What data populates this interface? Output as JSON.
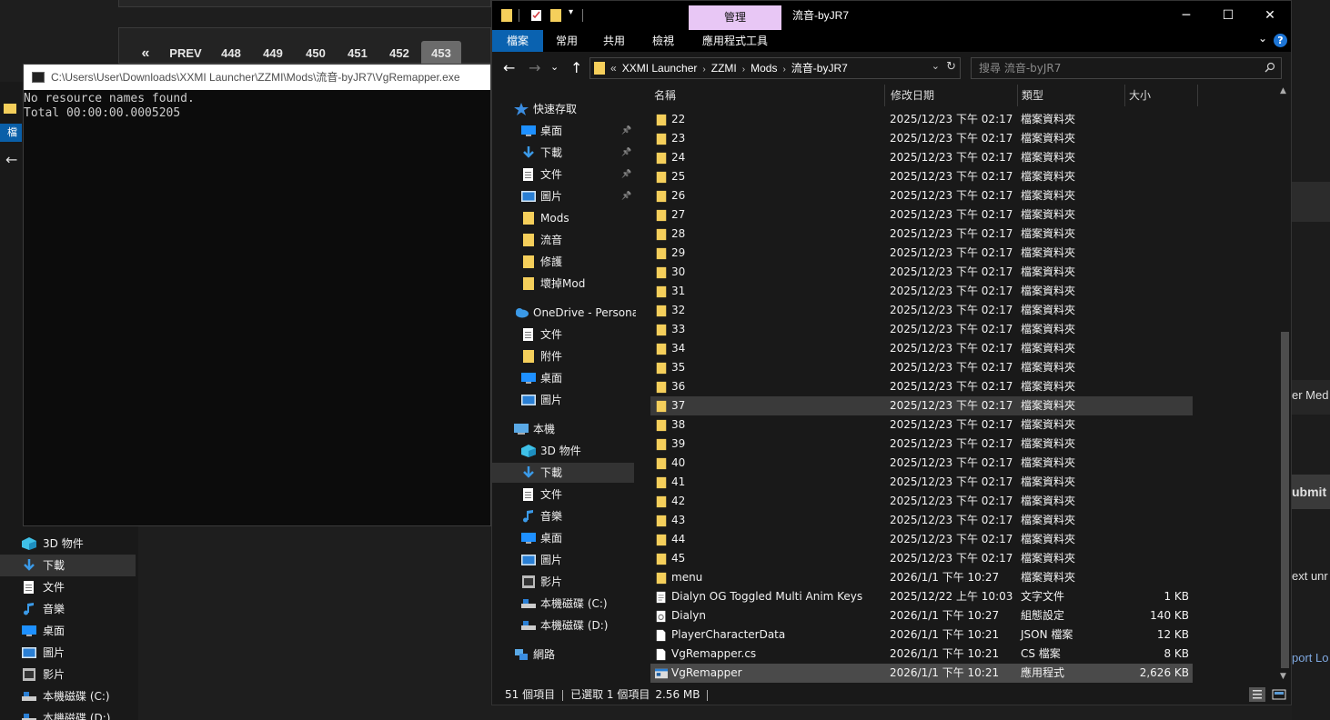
{
  "colors": {
    "folder": "#f5cf5b",
    "accent_blue": "#0a62b0",
    "manage_tab": "#e8c7f5",
    "selection": "#4a4a4a"
  },
  "background_page": {
    "pager": {
      "prev_symbol": "«",
      "prev_label": "PREV",
      "pages": [
        "448",
        "449",
        "450",
        "451",
        "452",
        "453"
      ],
      "active_page": "453"
    },
    "right_panel": {
      "text1": "er Med",
      "submit": "ubmit",
      "text2": "ext unr",
      "link": "port Lo"
    }
  },
  "console": {
    "title": "C:\\Users\\User\\Downloads\\XXMI Launcher\\ZZMI\\Mods\\流音-byJR7\\VgRemapper.exe",
    "output": "No resource names found.\nTotal 00:00:00.0005205"
  },
  "left_explorer": {
    "ribbon_label": "檔案",
    "nav_items": [
      {
        "label": "3D 物件",
        "icon": "3d-objects-icon"
      },
      {
        "label": "下載",
        "icon": "download-icon",
        "selected": true
      },
      {
        "label": "文件",
        "icon": "document-icon"
      },
      {
        "label": "音樂",
        "icon": "music-icon"
      },
      {
        "label": "桌面",
        "icon": "desktop-icon"
      },
      {
        "label": "圖片",
        "icon": "pictures-icon"
      },
      {
        "label": "影片",
        "icon": "videos-icon"
      },
      {
        "label": "本機磁碟 (C:)",
        "icon": "drive-icon"
      },
      {
        "label": "本機磁碟 (D:)",
        "icon": "drive-icon"
      }
    ]
  },
  "explorer": {
    "manage_tab": "管理",
    "title": "流音-byJR7",
    "window_buttons": {
      "minimize": "─",
      "maximize": "☐",
      "close": "✕"
    },
    "ribbon_tabs": [
      "檔案",
      "常用",
      "共用",
      "檢視",
      "應用程式工具"
    ],
    "address": {
      "prefix": "«",
      "crumbs": [
        "XXMI Launcher",
        "ZZMI",
        "Mods",
        "流音-byJR7"
      ]
    },
    "search_placeholder": "搜尋 流音-byJR7",
    "nav_pane": [
      {
        "label": "快速存取",
        "icon": "star-icon",
        "level": 0
      },
      {
        "label": "桌面",
        "icon": "desktop-icon",
        "level": 1,
        "pinned": true
      },
      {
        "label": "下載",
        "icon": "download-icon",
        "level": 1,
        "pinned": true
      },
      {
        "label": "文件",
        "icon": "document-icon",
        "level": 1,
        "pinned": true
      },
      {
        "label": "圖片",
        "icon": "pictures-icon",
        "level": 1,
        "pinned": true
      },
      {
        "label": "Mods",
        "icon": "folder-icon",
        "level": 1
      },
      {
        "label": "流音",
        "icon": "folder-icon",
        "level": 1
      },
      {
        "label": "修護",
        "icon": "folder-icon",
        "level": 1
      },
      {
        "label": "壞掉Mod",
        "icon": "folder-icon",
        "level": 1
      },
      {
        "label": "OneDrive - Personal",
        "icon": "cloud-icon",
        "level": 0
      },
      {
        "label": "文件",
        "icon": "document-icon",
        "level": 1
      },
      {
        "label": "附件",
        "icon": "folder-icon",
        "level": 1
      },
      {
        "label": "桌面",
        "icon": "desktop-icon",
        "level": 1
      },
      {
        "label": "圖片",
        "icon": "pictures-icon",
        "level": 1
      },
      {
        "label": "本機",
        "icon": "pc-icon",
        "level": 0
      },
      {
        "label": "3D 物件",
        "icon": "3d-objects-icon",
        "level": 1
      },
      {
        "label": "下載",
        "icon": "download-icon",
        "level": 1,
        "selected": true
      },
      {
        "label": "文件",
        "icon": "document-icon",
        "level": 1
      },
      {
        "label": "音樂",
        "icon": "music-icon",
        "level": 1
      },
      {
        "label": "桌面",
        "icon": "desktop-icon",
        "level": 1
      },
      {
        "label": "圖片",
        "icon": "pictures-icon",
        "level": 1
      },
      {
        "label": "影片",
        "icon": "videos-icon",
        "level": 1
      },
      {
        "label": "本機磁碟 (C:)",
        "icon": "drive-icon",
        "level": 1
      },
      {
        "label": "本機磁碟 (D:)",
        "icon": "drive-icon",
        "level": 1
      },
      {
        "label": "網路",
        "icon": "network-icon",
        "level": 0
      }
    ],
    "columns": [
      "名稱",
      "修改日期",
      "類型",
      "大小"
    ],
    "files": [
      {
        "name": "22",
        "date": "2025/12/23 下午 02:17",
        "type": "檔案資料夾",
        "size": "",
        "icon": "folder-icon"
      },
      {
        "name": "23",
        "date": "2025/12/23 下午 02:17",
        "type": "檔案資料夾",
        "size": "",
        "icon": "folder-icon"
      },
      {
        "name": "24",
        "date": "2025/12/23 下午 02:17",
        "type": "檔案資料夾",
        "size": "",
        "icon": "folder-icon"
      },
      {
        "name": "25",
        "date": "2025/12/23 下午 02:17",
        "type": "檔案資料夾",
        "size": "",
        "icon": "folder-icon"
      },
      {
        "name": "26",
        "date": "2025/12/23 下午 02:17",
        "type": "檔案資料夾",
        "size": "",
        "icon": "folder-icon"
      },
      {
        "name": "27",
        "date": "2025/12/23 下午 02:17",
        "type": "檔案資料夾",
        "size": "",
        "icon": "folder-icon"
      },
      {
        "name": "28",
        "date": "2025/12/23 下午 02:17",
        "type": "檔案資料夾",
        "size": "",
        "icon": "folder-icon"
      },
      {
        "name": "29",
        "date": "2025/12/23 下午 02:17",
        "type": "檔案資料夾",
        "size": "",
        "icon": "folder-icon"
      },
      {
        "name": "30",
        "date": "2025/12/23 下午 02:17",
        "type": "檔案資料夾",
        "size": "",
        "icon": "folder-icon"
      },
      {
        "name": "31",
        "date": "2025/12/23 下午 02:17",
        "type": "檔案資料夾",
        "size": "",
        "icon": "folder-icon"
      },
      {
        "name": "32",
        "date": "2025/12/23 下午 02:17",
        "type": "檔案資料夾",
        "size": "",
        "icon": "folder-icon"
      },
      {
        "name": "33",
        "date": "2025/12/23 下午 02:17",
        "type": "檔案資料夾",
        "size": "",
        "icon": "folder-icon"
      },
      {
        "name": "34",
        "date": "2025/12/23 下午 02:17",
        "type": "檔案資料夾",
        "size": "",
        "icon": "folder-icon"
      },
      {
        "name": "35",
        "date": "2025/12/23 下午 02:17",
        "type": "檔案資料夾",
        "size": "",
        "icon": "folder-icon"
      },
      {
        "name": "36",
        "date": "2025/12/23 下午 02:17",
        "type": "檔案資料夾",
        "size": "",
        "icon": "folder-icon"
      },
      {
        "name": "37",
        "date": "2025/12/23 下午 02:17",
        "type": "檔案資料夾",
        "size": "",
        "icon": "folder-icon",
        "hover": true
      },
      {
        "name": "38",
        "date": "2025/12/23 下午 02:17",
        "type": "檔案資料夾",
        "size": "",
        "icon": "folder-icon"
      },
      {
        "name": "39",
        "date": "2025/12/23 下午 02:17",
        "type": "檔案資料夾",
        "size": "",
        "icon": "folder-icon"
      },
      {
        "name": "40",
        "date": "2025/12/23 下午 02:17",
        "type": "檔案資料夾",
        "size": "",
        "icon": "folder-icon"
      },
      {
        "name": "41",
        "date": "2025/12/23 下午 02:17",
        "type": "檔案資料夾",
        "size": "",
        "icon": "folder-icon"
      },
      {
        "name": "42",
        "date": "2025/12/23 下午 02:17",
        "type": "檔案資料夾",
        "size": "",
        "icon": "folder-icon"
      },
      {
        "name": "43",
        "date": "2025/12/23 下午 02:17",
        "type": "檔案資料夾",
        "size": "",
        "icon": "folder-icon"
      },
      {
        "name": "44",
        "date": "2025/12/23 下午 02:17",
        "type": "檔案資料夾",
        "size": "",
        "icon": "folder-icon"
      },
      {
        "name": "45",
        "date": "2025/12/23 下午 02:17",
        "type": "檔案資料夾",
        "size": "",
        "icon": "folder-icon"
      },
      {
        "name": "menu",
        "date": "2026/1/1 下午 10:27",
        "type": "檔案資料夾",
        "size": "",
        "icon": "folder-icon"
      },
      {
        "name": "Dialyn OG Toggled Multi Anim Keys",
        "date": "2025/12/22 上午 10:03",
        "type": "文字文件",
        "size": "1 KB",
        "icon": "text-file-icon"
      },
      {
        "name": "Dialyn",
        "date": "2026/1/1 下午 10:27",
        "type": "組態設定",
        "size": "140 KB",
        "icon": "config-file-icon"
      },
      {
        "name": "PlayerCharacterData",
        "date": "2026/1/1 下午 10:21",
        "type": "JSON 檔案",
        "size": "12 KB",
        "icon": "file-icon"
      },
      {
        "name": "VgRemapper.cs",
        "date": "2026/1/1 下午 10:21",
        "type": "CS 檔案",
        "size": "8 KB",
        "icon": "file-icon"
      },
      {
        "name": "VgRemapper",
        "date": "2026/1/1 下午 10:21",
        "type": "應用程式",
        "size": "2,626 KB",
        "icon": "exe-icon",
        "selected": true
      }
    ],
    "status": {
      "count": "51 個項目",
      "selected": "已選取 1 個項目",
      "size": "2.56 MB"
    }
  }
}
